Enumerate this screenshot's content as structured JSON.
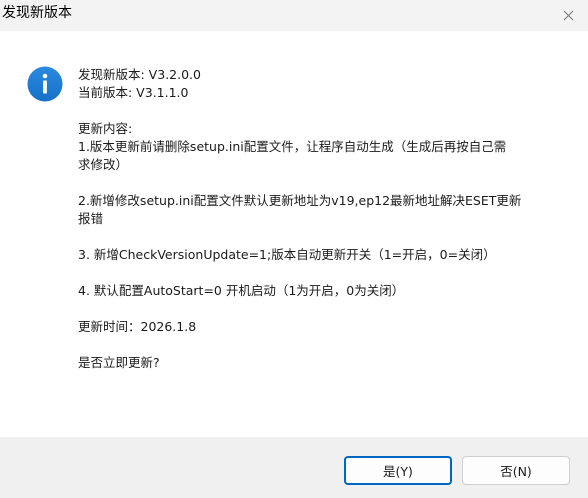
{
  "window": {
    "title": "发现新版本"
  },
  "message": {
    "new_version": "发现新版本: V3.2.0.0",
    "current_version": "当前版本: V3.1.1.0",
    "changelog_header": "更新内容:",
    "item1_line1": "1.版本更新前请删除setup.ini配置文件，让程序自动生成（生成后再按自己需",
    "item1_line2": "求修改）",
    "item2_line1": "2.新增修改setup.ini配置文件默认更新地址为v19,ep12最新地址解决ESET更新",
    "item2_line2": "报错",
    "item3": "3. 新增CheckVersionUpdate=1;版本自动更新开关（1=开启，0=关闭）",
    "item4": "4. 默认配置AutoStart=0 开机启动（1为开启，0为关闭）",
    "update_time": "更新时间：2026.1.8",
    "prompt": "是否立即更新?"
  },
  "buttons": {
    "yes_label": "是(Y)",
    "no_label": "否(N)"
  },
  "icons": {
    "info": "info-icon",
    "close": "close-icon"
  },
  "colors": {
    "info_icon": "#1d7fd8",
    "accent_border": "#0067c0",
    "footer_bg": "#f0f0f0"
  }
}
